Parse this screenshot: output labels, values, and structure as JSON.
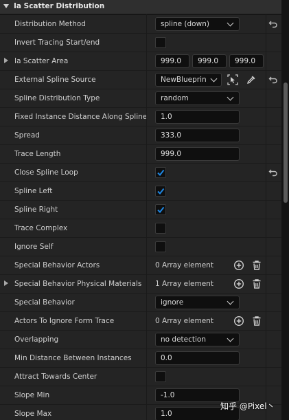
{
  "section": {
    "title": "Ia Scatter Distribution"
  },
  "rows": [
    {
      "label": "Distribution Method",
      "value": "spline (down)"
    },
    {
      "label": "Invert Tracing Start/end",
      "checked": false
    },
    {
      "label": "Ia Scatter Area",
      "x": "999.0",
      "y": "999.0",
      "z": "999.0"
    },
    {
      "label": "External Spline Source",
      "value": "NewBlueprin"
    },
    {
      "label": "Spline Distribution Type",
      "value": "random"
    },
    {
      "label": "Fixed Instance Distance Along Spline",
      "value": "1.0"
    },
    {
      "label": "Spread",
      "value": "333.0"
    },
    {
      "label": "Trace Length",
      "value": "999.0"
    },
    {
      "label": "Close Spline Loop",
      "checked": true
    },
    {
      "label": "Spline Left",
      "checked": true
    },
    {
      "label": "Spline Right",
      "checked": true
    },
    {
      "label": "Trace Complex",
      "checked": false
    },
    {
      "label": "Ignore Self",
      "checked": false
    },
    {
      "label": "Special Behavior Actors",
      "value": "0 Array element"
    },
    {
      "label": "Special Behavior Physical Materials",
      "value": "1 Array element"
    },
    {
      "label": "Special Behavior",
      "value": "ignore"
    },
    {
      "label": "Actors To Ignore Form Trace",
      "value": "0 Array element"
    },
    {
      "label": "Overlapping",
      "value": "no detection"
    },
    {
      "label": "Min Distance Between Instances",
      "value": "0.0"
    },
    {
      "label": "Attract Towards Center",
      "checked": false
    },
    {
      "label": "Slope Min",
      "value": "-1.0"
    },
    {
      "label": "Slope Max",
      "value": "1.0"
    }
  ],
  "watermark": "知乎 @Pixel丶",
  "colors": {
    "checkmark": "#1e88e5",
    "field_bg": "#0f0f0f",
    "row_bg": "#242424",
    "header_bg": "#2f2f2f"
  },
  "icons": [
    "collapse-arrow-icon",
    "expand-arrow-icon",
    "chevron-down-icon",
    "reset-arrow-icon",
    "checkmark-icon",
    "select-actor-icon",
    "eyedropper-icon",
    "add-circle-icon",
    "trash-icon"
  ]
}
